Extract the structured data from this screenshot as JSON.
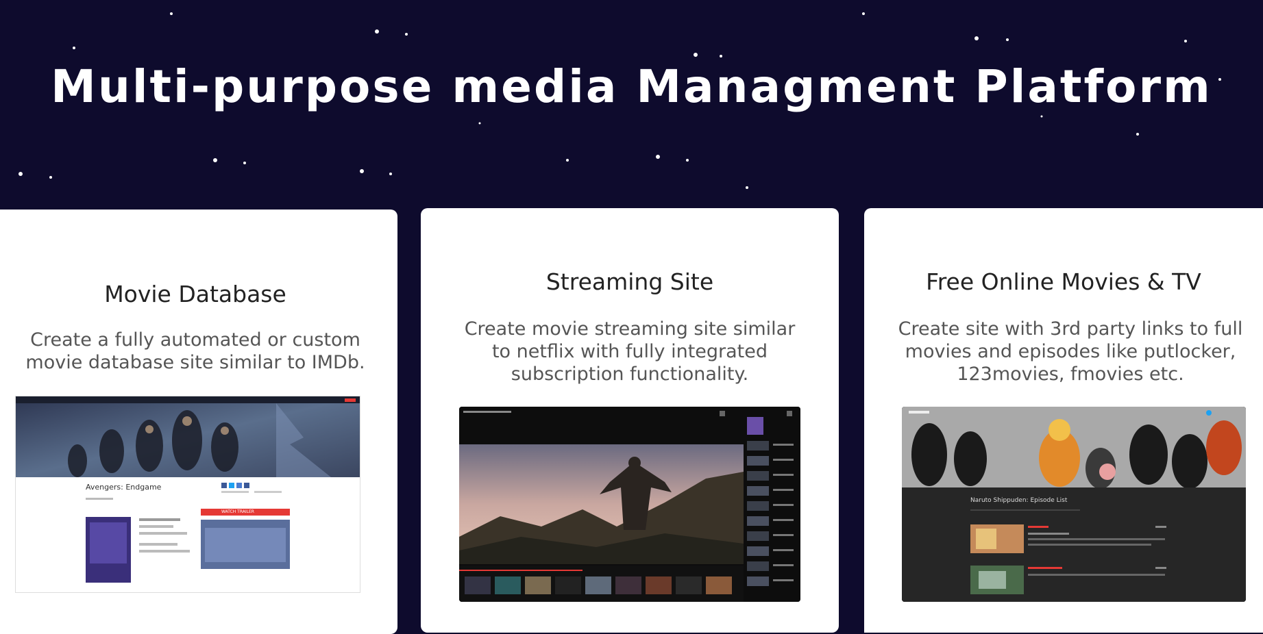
{
  "hero": {
    "title": "Multi-purpose media Managment Platform"
  },
  "cards": [
    {
      "title": "Movie Database",
      "description": "Create a fully automated or custom movie database site similar to IMDb.",
      "screenshot": {
        "movie_title": "Avengers: Endgame",
        "cta": "WATCH TRAILER"
      }
    },
    {
      "title": "Streaming Site",
      "description": "Create movie streaming site similar to netflix with fully integrated subscription functionality."
    },
    {
      "title": "Free Online Movies & TV",
      "description": "Create site with 3rd party links to full movies and episodes like putlocker, 123movies, fmovies etc.",
      "screenshot": {
        "show_title": "Naruto Shippuden: Episode List"
      }
    }
  ],
  "colors": {
    "background": "#0e0b2d",
    "card": "#ffffff",
    "accent_red": "#e53935"
  }
}
